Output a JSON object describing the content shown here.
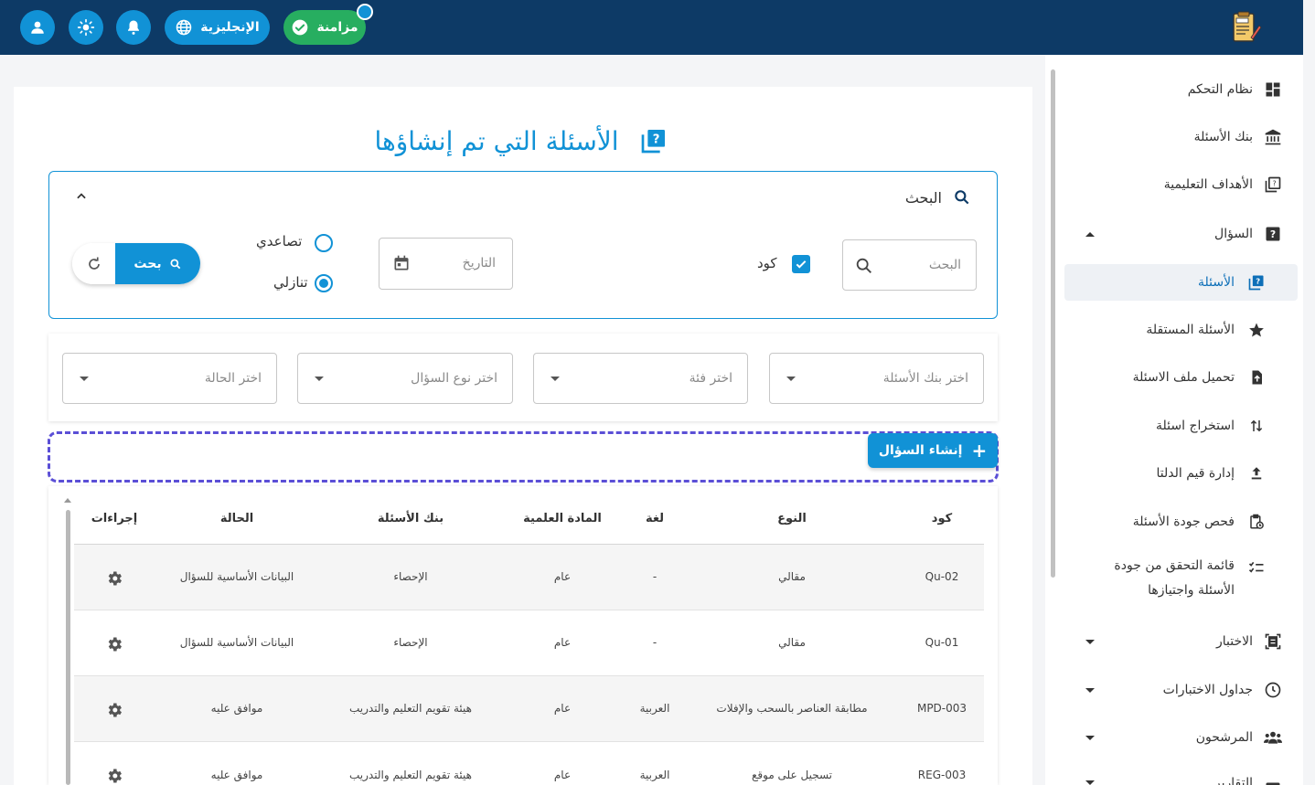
{
  "topbar": {
    "sync_label": "مزامنة",
    "language_label": "الإنجليزية"
  },
  "sidebar": {
    "items": [
      {
        "label": "نظام التحكم",
        "icon": "dashboard-icon"
      },
      {
        "label": "بنك الأسئلة",
        "icon": "bank-icon"
      },
      {
        "label": "الأهداف التعليمية",
        "icon": "objectives-icon"
      },
      {
        "label": "السؤال",
        "icon": "question-icon",
        "expanded": true
      },
      {
        "label": "الأسئلة",
        "icon": "questions-icon",
        "active": true
      },
      {
        "label": "الأسئلة المستقلة",
        "icon": "star-icon"
      },
      {
        "label": "تحميل ملف الاسئلة",
        "icon": "file-upload-icon"
      },
      {
        "label": "استخراج اسئلة",
        "icon": "swap-vertical-icon"
      },
      {
        "label": "إدارة قيم الدلتا",
        "icon": "upload-icon"
      },
      {
        "label": "فحص جودة الأسئلة",
        "icon": "clipboard-clock-icon"
      },
      {
        "label": "قائمة التحقق من جودة",
        "label2": "الأسئلة واجتيازها",
        "icon": "checklist-icon"
      },
      {
        "label": "الاختبار",
        "icon": "exam-icon",
        "expandable": true
      },
      {
        "label": "جداول الاختبارات",
        "icon": "clock-icon",
        "expandable": true
      },
      {
        "label": "المرشحون",
        "icon": "people-icon",
        "expandable": true
      },
      {
        "label": "التقارير",
        "icon": "reports-icon",
        "expandable": true
      }
    ]
  },
  "page": {
    "title": "الأسئلة التي تم إنشاؤها"
  },
  "search": {
    "heading": "البحث",
    "input_placeholder": "البحث",
    "code_checkbox_label": "كود",
    "date_placeholder": "التاريخ",
    "sort_asc_label": "تصاعدي",
    "sort_desc_label": "تنازلي",
    "sort_selected": "desc",
    "search_button": "بحث"
  },
  "filters": {
    "bank_placeholder": "اختر بنك الأسئلة",
    "category_placeholder": "اختر فئة",
    "type_placeholder": "اختر نوع السؤال",
    "status_placeholder": "اختر الحالة"
  },
  "create_button": "إنشاء السؤال",
  "table": {
    "headers": {
      "code": "كود",
      "type": "النوع",
      "language": "لغة",
      "subject": "المادة العلمية",
      "bank": "بنك الأسئلة",
      "status": "الحالة",
      "actions": "إجراءات"
    },
    "rows": [
      {
        "code": "Qu-02",
        "type": "مقالي",
        "language": "-",
        "subject": "عام",
        "bank": "الإحصاء",
        "status": "البيانات الأساسية للسؤال"
      },
      {
        "code": "Qu-01",
        "type": "مقالي",
        "language": "-",
        "subject": "عام",
        "bank": "الإحصاء",
        "status": "البيانات الأساسية للسؤال"
      },
      {
        "code": "MPD-003",
        "type": "مطابقة العناصر بالسحب والإفلات",
        "language": "العربية",
        "subject": "عام",
        "bank": "هيئة تقويم التعليم والتدريب",
        "status": "موافق عليه"
      },
      {
        "code": "REG-003",
        "type": "تسجيل على موقع",
        "language": "العربية",
        "subject": "عام",
        "bank": "هيئة تقويم التعليم والتدريب",
        "status": "موافق عليه"
      }
    ]
  },
  "colors": {
    "topbar": "#0d3a66",
    "accent": "#1192d6",
    "sync": "#27ae60",
    "dashed_border": "#5b4fd6"
  }
}
